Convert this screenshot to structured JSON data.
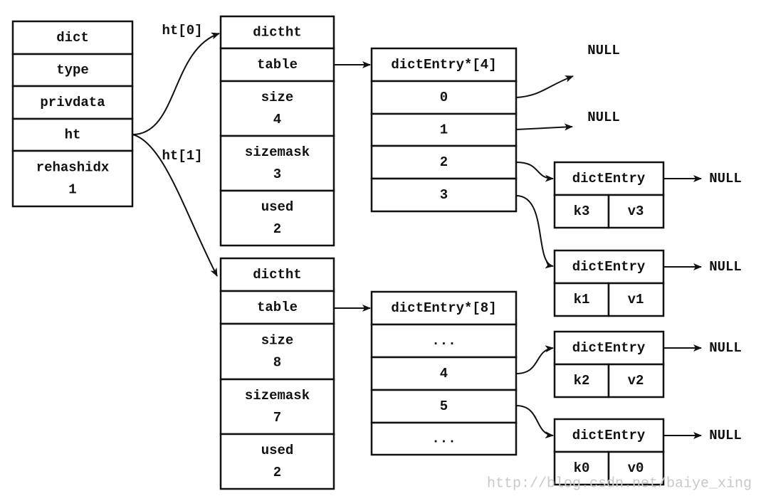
{
  "dict": {
    "rows": [
      [
        "dict"
      ],
      [
        "type"
      ],
      [
        "privdata"
      ],
      [
        "ht"
      ],
      [
        "rehashidx",
        "1"
      ]
    ]
  },
  "ht_labels": [
    "ht[0]",
    "ht[1]"
  ],
  "dictht0": {
    "rows": [
      [
        "dictht"
      ],
      [
        "table"
      ],
      [
        "size",
        "4"
      ],
      [
        "sizemask",
        "3"
      ],
      [
        "used",
        "2"
      ]
    ]
  },
  "dictht1": {
    "rows": [
      [
        "dictht"
      ],
      [
        "table"
      ],
      [
        "size",
        "8"
      ],
      [
        "sizemask",
        "7"
      ],
      [
        "used",
        "2"
      ]
    ]
  },
  "table0": {
    "rows": [
      [
        "dictEntry*[4]"
      ],
      [
        "0"
      ],
      [
        "1"
      ],
      [
        "2"
      ],
      [
        "3"
      ]
    ]
  },
  "table1": {
    "rows": [
      [
        "dictEntry*[8]"
      ],
      [
        "..."
      ],
      [
        "4"
      ],
      [
        "5"
      ],
      [
        "..."
      ]
    ]
  },
  "null_label": "NULL",
  "entries": [
    {
      "title": "dictEntry",
      "key": "k3",
      "value": "v3",
      "next": "NULL"
    },
    {
      "title": "dictEntry",
      "key": "k1",
      "value": "v1",
      "next": "NULL"
    },
    {
      "title": "dictEntry",
      "key": "k2",
      "value": "v2",
      "next": "NULL"
    },
    {
      "title": "dictEntry",
      "key": "k0",
      "value": "v0",
      "next": "NULL"
    }
  ],
  "watermark": "http://blog.csdn.net/baiye_xing"
}
